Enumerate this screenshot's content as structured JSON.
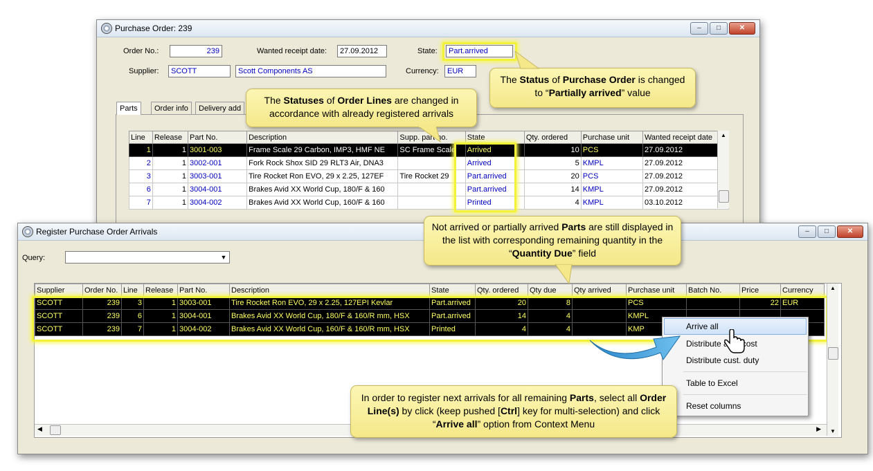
{
  "po_window": {
    "title": "Purchase Order: 239",
    "order_no_label": "Order No.:",
    "order_no": "239",
    "wanted_label": "Wanted receipt date:",
    "wanted_date": "27.09.2012",
    "state_label": "State:",
    "state": "Part.arrived",
    "supplier_label": "Supplier:",
    "supplier_code": "SCOTT",
    "supplier_name": "Scott Components AS",
    "currency_label": "Currency:",
    "currency": "EUR",
    "tabs": [
      "Parts",
      "Order info",
      "Delivery add"
    ],
    "columns": [
      "Line",
      "Release",
      "Part No.",
      "Description",
      "Supp. part no.",
      "State",
      "Qty. ordered",
      "Purchase unit",
      "Wanted receipt date"
    ],
    "rows": [
      {
        "line": "1",
        "release": "1",
        "part": "3001-003",
        "desc": "Frame Scale 29 Carbon, IMP3, HMF NE",
        "supp": "SC Frame Scale",
        "state": "Arrived",
        "qty": "10",
        "unit": "PCS",
        "date": "27.09.2012"
      },
      {
        "line": "2",
        "release": "1",
        "part": "3002-001",
        "desc": "Fork Rock Shox SID 29 RLT3 Air, DNA3",
        "supp": "",
        "state": "Arrived",
        "qty": "5",
        "unit": "KMPL",
        "date": "27.09.2012"
      },
      {
        "line": "3",
        "release": "1",
        "part": "3003-001",
        "desc": "Tire Rocket Ron EVO, 29 x 2.25, 127EF",
        "supp": "Tire Rocket 29",
        "state": "Part.arrived",
        "qty": "20",
        "unit": "PCS",
        "date": "27.09.2012"
      },
      {
        "line": "6",
        "release": "1",
        "part": "3004-001",
        "desc": "Brakes Avid XX World Cup, 180/F & 160",
        "supp": "",
        "state": "Part.arrived",
        "qty": "14",
        "unit": "KMPL",
        "date": "27.09.2012"
      },
      {
        "line": "7",
        "release": "1",
        "part": "3004-002",
        "desc": "Brakes Avid XX World Cup, 160/F & 160",
        "supp": "",
        "state": "Printed",
        "qty": "4",
        "unit": "KMPL",
        "date": "03.10.2012"
      }
    ]
  },
  "arrivals_window": {
    "title": "Register Purchase Order Arrivals",
    "query_label": "Query:",
    "query_value": "",
    "columns": [
      "Supplier",
      "Order No.",
      "Line",
      "Release",
      "Part No.",
      "Description",
      "State",
      "Qty. ordered",
      "Qty due",
      "Qty arrived",
      "Purchase unit",
      "Batch No.",
      "Price",
      "Currency"
    ],
    "rows": [
      {
        "supplier": "SCOTT",
        "order": "239",
        "line": "3",
        "release": "1",
        "part": "3003-001",
        "desc": "Tire Rocket Ron EVO, 29 x 2.25, 127EPI Kevlar",
        "state": "Part.arrived",
        "qty": "20",
        "due": "8",
        "arrived": "",
        "unit": "PCS",
        "batch": "",
        "price": "22",
        "currency": "EUR"
      },
      {
        "supplier": "SCOTT",
        "order": "239",
        "line": "6",
        "release": "1",
        "part": "3004-001",
        "desc": "Brakes Avid XX World Cup, 180/F & 160/R mm, HSX",
        "state": "Part.arrived",
        "qty": "14",
        "due": "4",
        "arrived": "",
        "unit": "KMPL",
        "batch": "",
        "price": "",
        "currency": ""
      },
      {
        "supplier": "SCOTT",
        "order": "239",
        "line": "7",
        "release": "1",
        "part": "3004-002",
        "desc": "Brakes Avid XX World Cup, 160/F & 160/R mm, HSX",
        "state": "Printed",
        "qty": "4",
        "due": "4",
        "arrived": "",
        "unit": "KMP",
        "batch": "",
        "price": "",
        "currency": ""
      }
    ]
  },
  "context_menu": {
    "items": [
      "Arrive all",
      "Distribute add. cost",
      "Distribute cust. duty",
      "Table to Excel",
      "Reset columns"
    ]
  },
  "callouts": {
    "statuses_1": "The ",
    "statuses_2": "Statuses",
    "statuses_3": " of ",
    "statuses_4": "Order Lines",
    "statuses_5": " are changed  in accordance with already registered arrivals",
    "status_1": "The ",
    "status_2": "Status",
    "status_3": " of ",
    "status_4": "Purchase Order",
    "status_5": " is changed to “",
    "status_6": "Partially arrived",
    "status_7": "” value",
    "notarrived_1": "Not arrived or partially arrived ",
    "notarrived_2": "Parts",
    "notarrived_3": " are still displayed in the list with corresponding remaining quantity in the “",
    "notarrived_4": "Quantity Due",
    "notarrived_5": "” field",
    "howto_1": "In order to register next arrivals for all remaining ",
    "howto_2": "Parts",
    "howto_3": ", select all ",
    "howto_4": "Order Line(s)",
    "howto_5": " by click (keep pushed [",
    "howto_6": "Ctrl",
    "howto_7": "] key for multi-selection) and click “",
    "howto_8": "Arrive all",
    "howto_9": "” option from Context Menu"
  },
  "colors": {
    "highlight": "#f2f23a",
    "selected_row_bg": "#000000",
    "selected_row_text": "#ffff66",
    "callout_bg": "#f8ef9c",
    "value_blue": "#0000c0"
  }
}
